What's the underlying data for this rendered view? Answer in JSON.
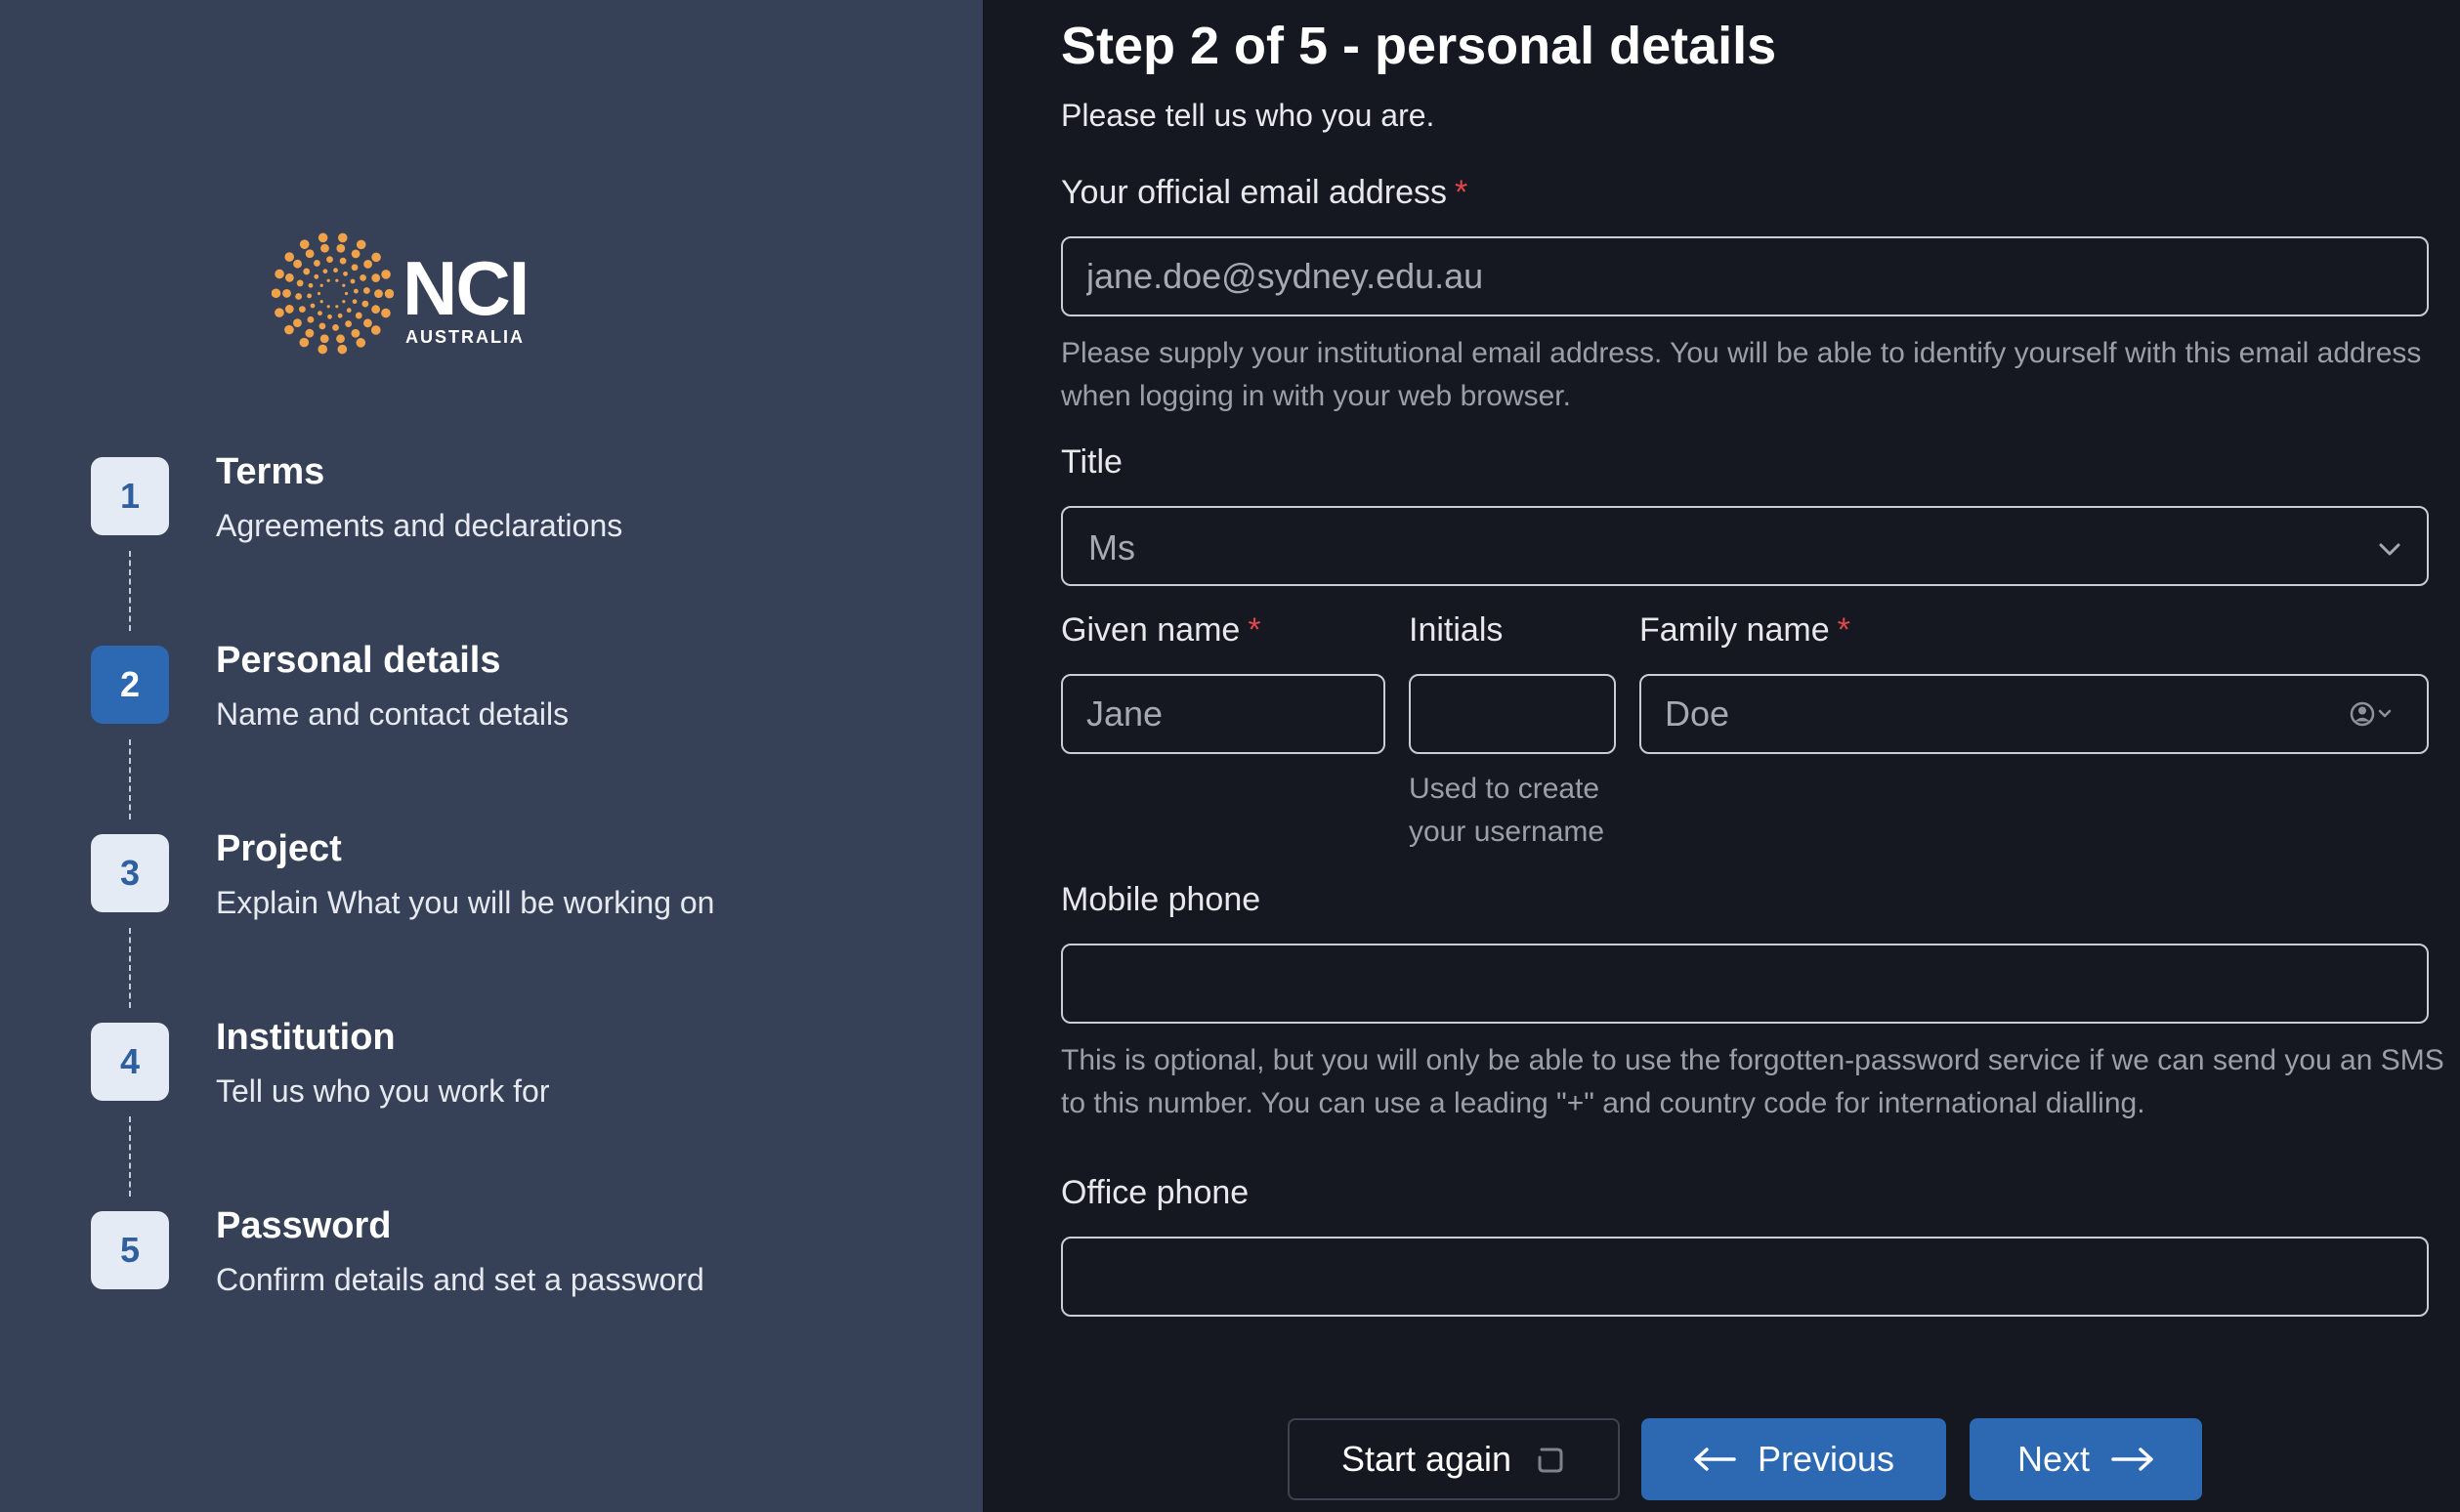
{
  "brand": {
    "logo_text": "NCI",
    "logo_subtext": "AUSTRALIA",
    "accent_color": "#f0a24b"
  },
  "steps": [
    {
      "number": "1",
      "title": "Terms",
      "description": "Agreements and declarations",
      "active": false
    },
    {
      "number": "2",
      "title": "Personal details",
      "description": "Name and contact details",
      "active": true
    },
    {
      "number": "3",
      "title": "Project",
      "description": "Explain What you will be working on",
      "active": false
    },
    {
      "number": "4",
      "title": "Institution",
      "description": "Tell us who you work for",
      "active": false
    },
    {
      "number": "5",
      "title": "Password",
      "description": "Confirm details and set a password",
      "active": false
    }
  ],
  "form": {
    "heading": "Step 2 of 5 - personal details",
    "subheading": "Please tell us who you are.",
    "email": {
      "label": "Your official email address",
      "required_mark": "*",
      "placeholder": "jane.doe@sydney.edu.au",
      "value": "",
      "help": "Please supply your institutional email address. You will be able to identify yourself with this email address when logging in with your web browser."
    },
    "title": {
      "label": "Title",
      "selected": "Ms",
      "icon": "chevron-down-icon"
    },
    "given_name": {
      "label": "Given name",
      "required_mark": "*",
      "placeholder": "Jane",
      "value": ""
    },
    "initials": {
      "label": "Initials",
      "value": "",
      "help": "Used to create your username"
    },
    "family_name": {
      "label": "Family name",
      "required_mark": "*",
      "placeholder": "Doe",
      "value": "",
      "icon": "user-autofill-icon"
    },
    "mobile_phone": {
      "label": "Mobile phone",
      "value": "",
      "help": "This is optional, but you will only be able to use the forgotten-password service if we can send you an SMS to this number. You can use a leading \"+\" and country code for international dialling."
    },
    "office_phone": {
      "label": "Office phone",
      "value": ""
    }
  },
  "buttons": {
    "start_again": {
      "label": "Start again",
      "icon": "reset-icon"
    },
    "previous": {
      "label": "Previous",
      "icon": "arrow-left-icon"
    },
    "next": {
      "label": "Next",
      "icon": "arrow-right-icon"
    }
  },
  "colors": {
    "sidebar_bg": "#364157",
    "main_bg": "#161821",
    "primary": "#2d68b3",
    "required": "#e0474c"
  }
}
